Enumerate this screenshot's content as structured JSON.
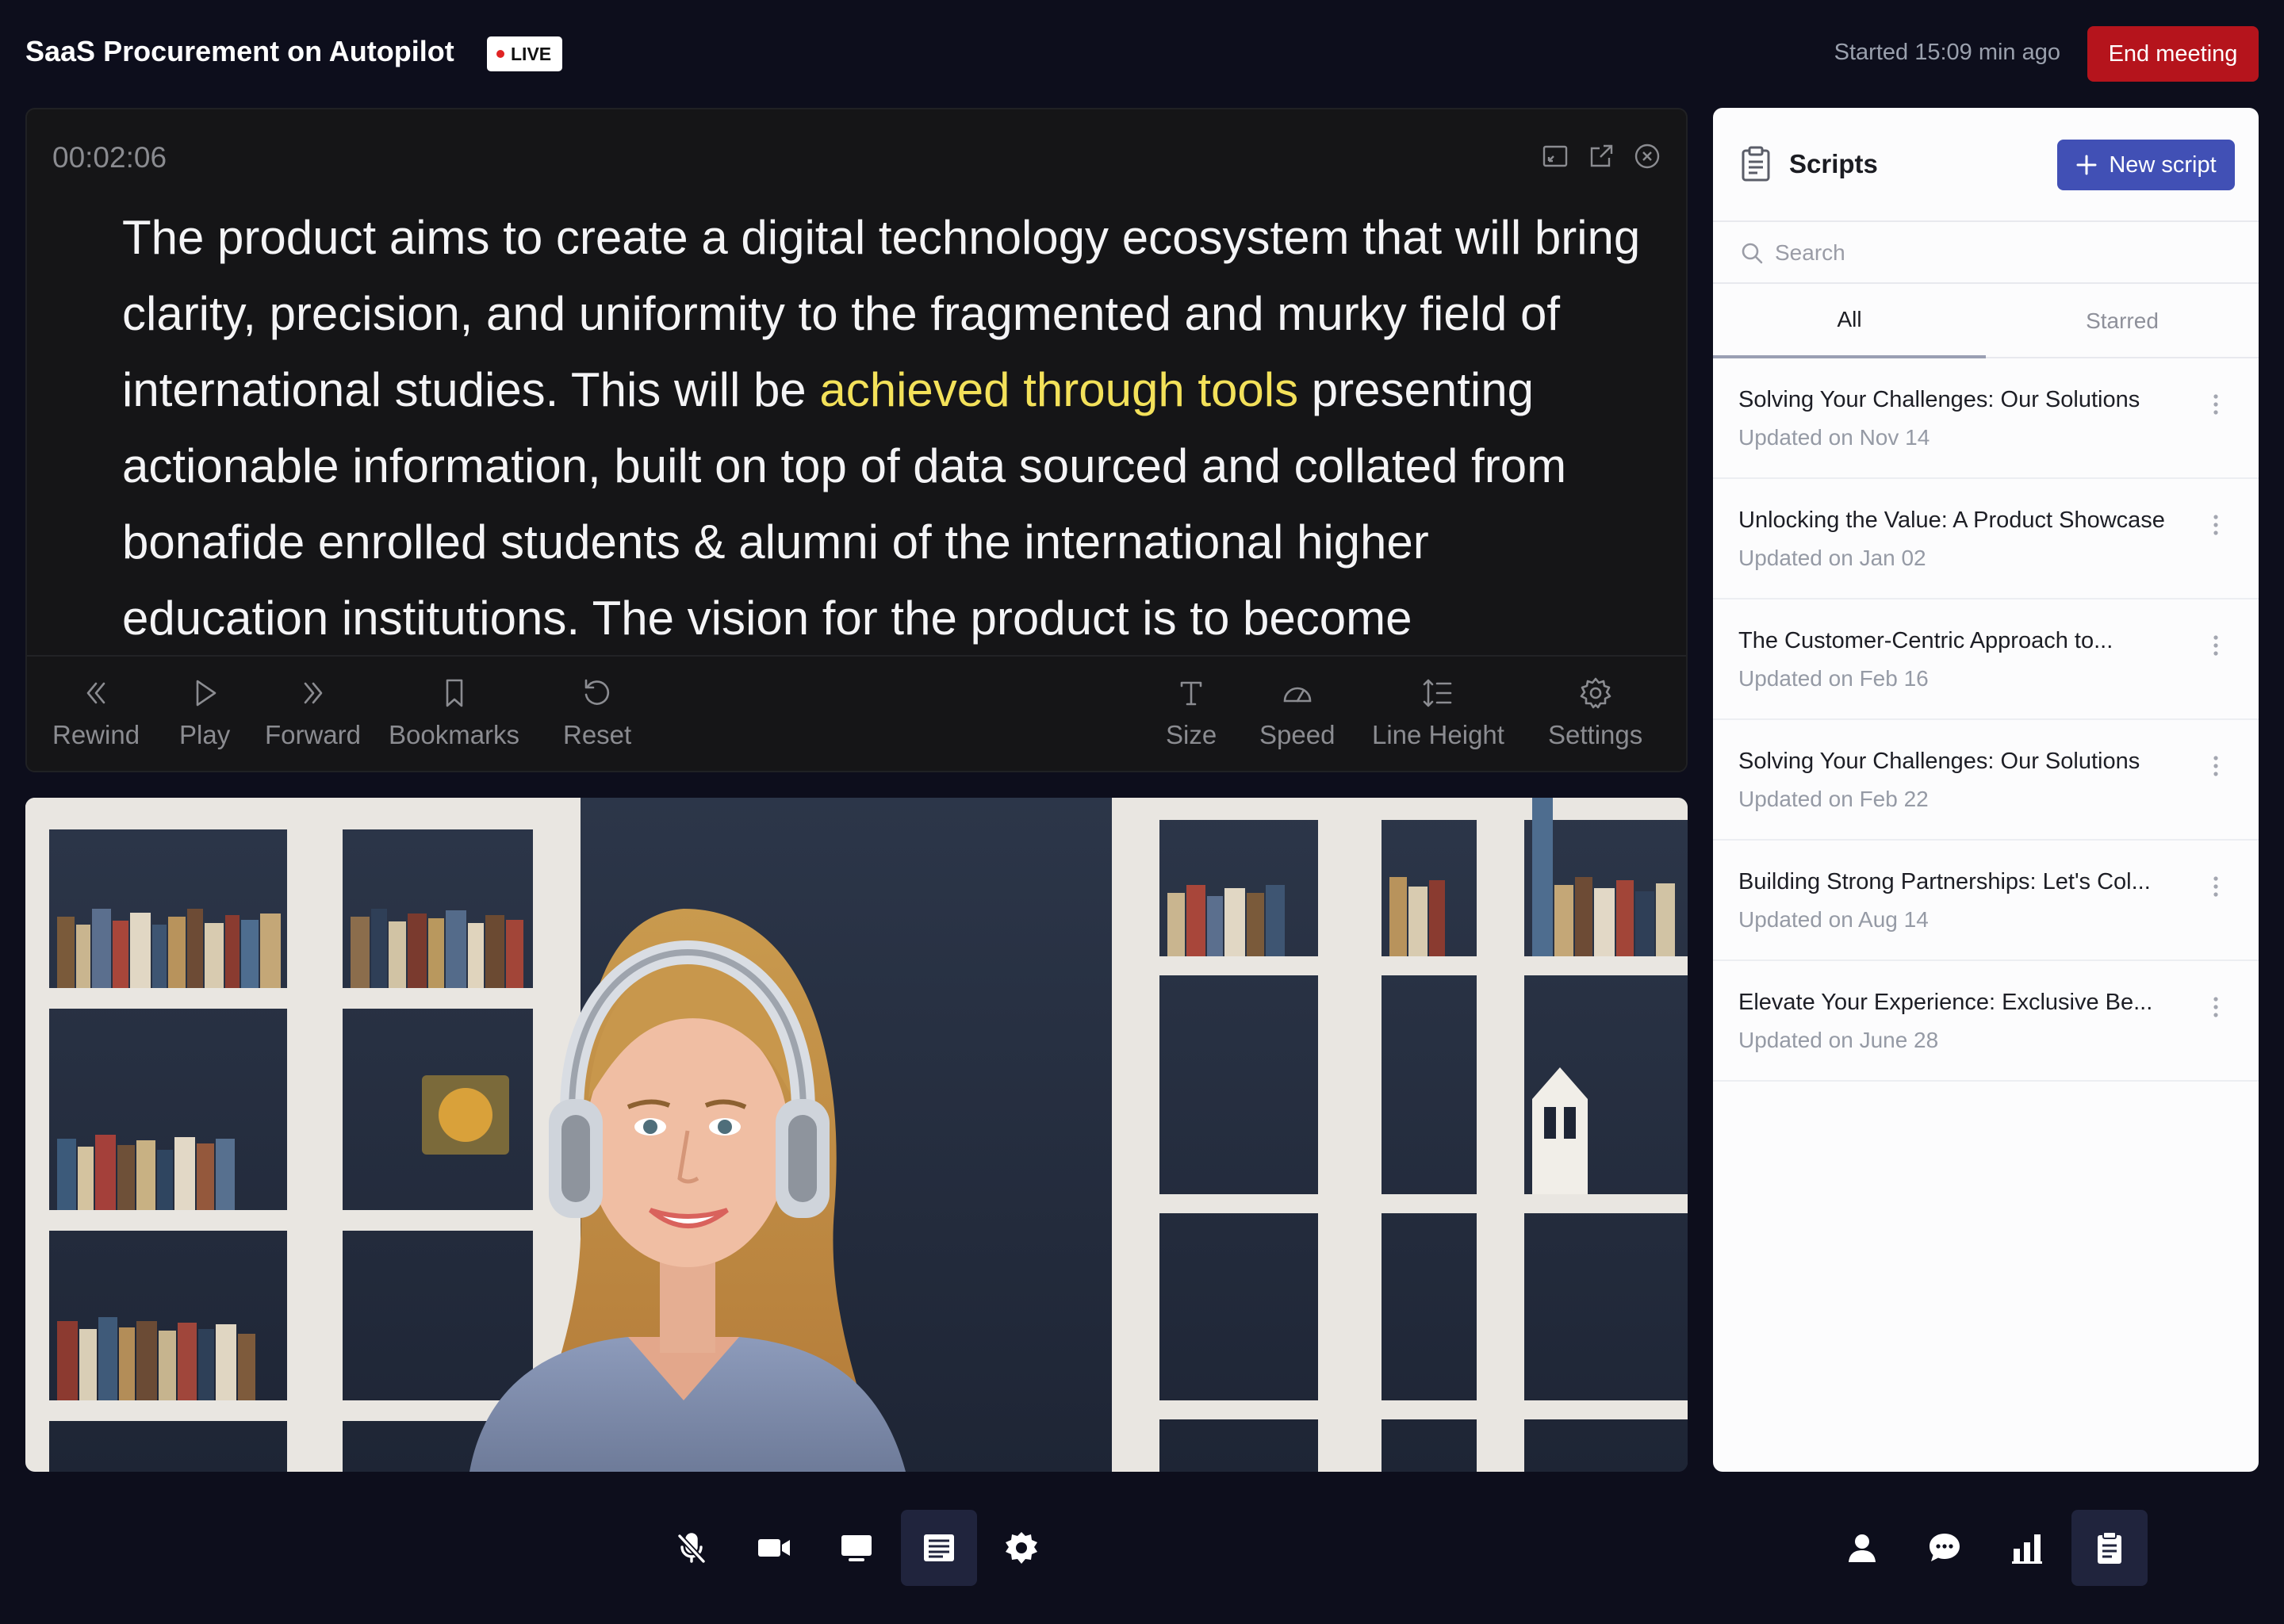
{
  "header": {
    "title": "SaaS Procurement on Autopilot",
    "live_label": "LIVE",
    "started": "Started 15:09 min ago",
    "end_button": "End meeting"
  },
  "prompter": {
    "timer": "00:02:06",
    "text_before": "The product aims to create a digital technology ecosystem that will bring clarity, precision, and uniformity to the fragmented and murky field of international studies. This will be ",
    "text_highlight": "achieved through tools",
    "text_after": " presenting actionable information, built on top of data sourced and collated from bonafide enrolled students & alumni of the international higher education institutions. The vision for the product is to become",
    "controls": {
      "rewind": "Rewind",
      "play": "Play",
      "forward": "Forward",
      "bookmarks": "Bookmarks",
      "reset": "Reset",
      "size": "Size",
      "speed": "Speed",
      "line_height": "Line Height",
      "settings": "Settings"
    },
    "highlight_color": "#f3e15a"
  },
  "scripts": {
    "title": "Scripts",
    "new_button": "New script",
    "search_placeholder": "Search",
    "tabs": [
      "All",
      "Starred"
    ],
    "items": [
      {
        "title": "Solving Your Challenges: Our Solutions",
        "date": "Updated on Nov 14"
      },
      {
        "title": "Unlocking the Value: A Product Showcase",
        "date": "Updated on Jan 02"
      },
      {
        "title": "The Customer-Centric Approach to...",
        "date": "Updated on Feb 16"
      },
      {
        "title": "Solving Your Challenges: Our Solutions",
        "date": "Updated on Feb 22"
      },
      {
        "title": "Building Strong Partnerships: Let's Col...",
        "date": "Updated on Aug 14"
      },
      {
        "title": "Elevate Your Experience: Exclusive Be...",
        "date": "Updated on June 28"
      }
    ]
  },
  "colors": {
    "background": "#0d0e1c",
    "end_button": "#b5141c",
    "accent": "#4150b5",
    "live_dot": "#e02424"
  },
  "toolbar_icons": [
    "mic-off-icon",
    "camera-icon",
    "screen-share-icon",
    "teleprompter-icon",
    "settings-icon",
    "participants-icon",
    "chat-icon",
    "stats-icon",
    "scripts-icon"
  ]
}
